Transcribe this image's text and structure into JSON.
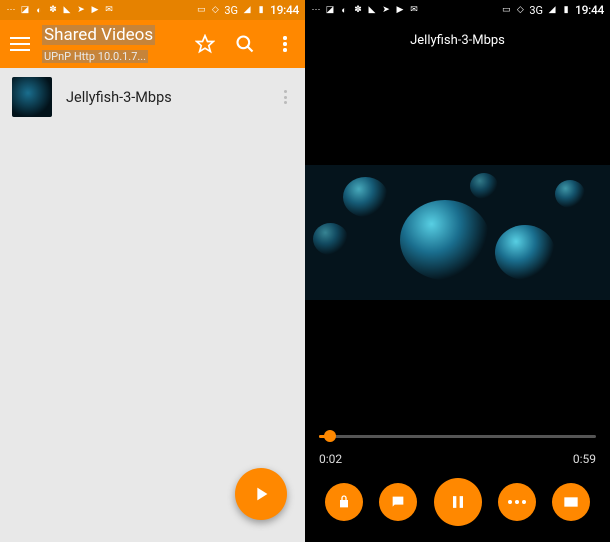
{
  "statusbar": {
    "time": "19:44",
    "network": "3G"
  },
  "left": {
    "toolbar": {
      "title": "Shared Videos",
      "subtitle": "UPnP Http 10.0.1.7..."
    },
    "list": [
      {
        "title": "Jellyfish-3-Mbps"
      }
    ]
  },
  "player": {
    "title": "Jellyfish-3-Mbps",
    "elapsed": "0:02",
    "total": "0:59"
  }
}
